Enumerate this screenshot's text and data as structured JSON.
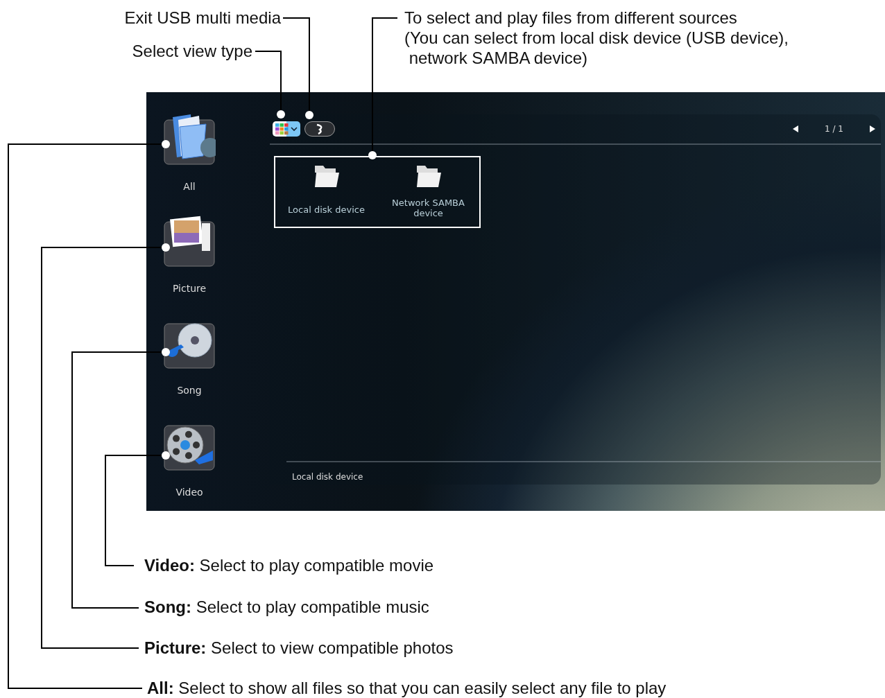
{
  "callouts_top": [
    {
      "kind": "exit",
      "text": "Exit USB multi media"
    },
    {
      "kind": "view",
      "text": "Select view type"
    },
    {
      "kind": "sources",
      "lines": [
        "To select and play files from different sources",
        "(You can select from local disk device (USB device),",
        " network SAMBA device)"
      ]
    }
  ],
  "screen": {
    "categories": [
      {
        "kind": "all",
        "label": "All"
      },
      {
        "kind": "picture",
        "label": "Picture"
      },
      {
        "kind": "song",
        "label": "Song"
      },
      {
        "kind": "video",
        "label": "Video"
      }
    ],
    "page_indicator": "1 / 1",
    "sources": [
      {
        "label": "Local disk device"
      },
      {
        "label": "Network SAMBA device"
      }
    ],
    "status": "Local disk device"
  },
  "callouts_bottom": [
    {
      "kind": "video",
      "text": "**Video:** Select to play compatible movie"
    },
    {
      "kind": "song",
      "text": "**Song:** Select to play compatible music"
    },
    {
      "kind": "picture",
      "text": "**Picture:** Select to view compatible photos"
    },
    {
      "kind": "all",
      "text": "**All:** Select to show all files so that you can easily select any file to play"
    }
  ]
}
